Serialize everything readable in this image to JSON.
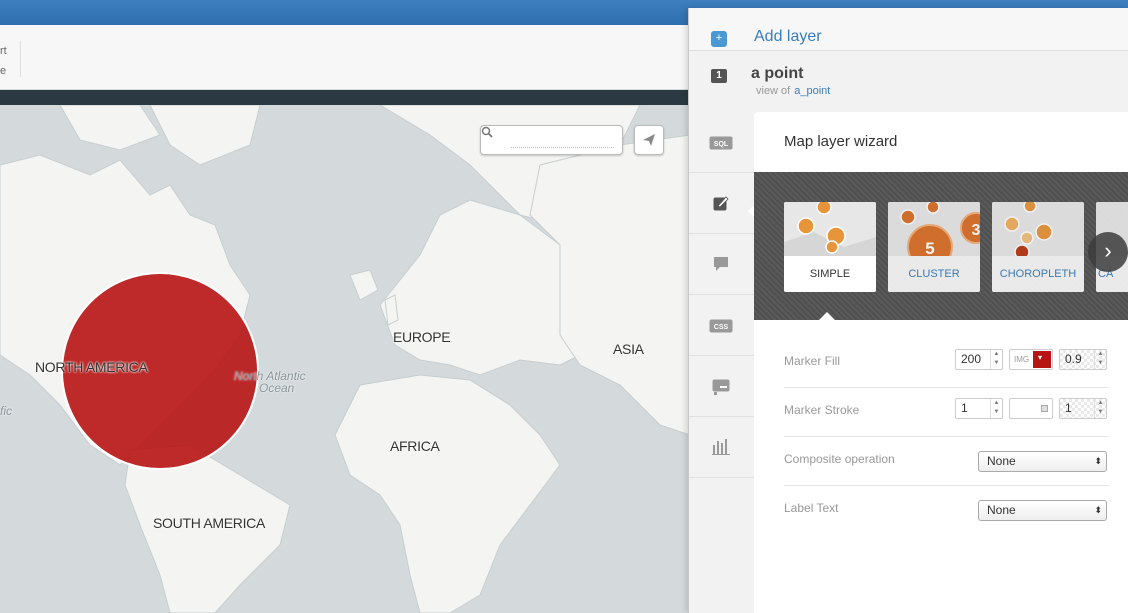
{
  "toolbar": {
    "fragment_line1": "rt",
    "fragment_line2": "e"
  },
  "map": {
    "search": {
      "placeholder": ""
    },
    "labels": {
      "north_america": "NORTH AMERICA",
      "europe": "EUROPE",
      "asia": "ASIA",
      "africa": "AFRICA",
      "south_america": "SOUTH AMERICA",
      "north_atlantic_line1": "North Atlantic",
      "north_atlantic_line2": "Ocean",
      "pacific_fragment": "fic"
    },
    "colors": {
      "water": "#d4dadc",
      "land": "#f4f4f2",
      "marker": "#b81414"
    }
  },
  "panel": {
    "add_layer": {
      "icon": "+",
      "label": "Add layer"
    },
    "layer": {
      "number": "1",
      "name": "a point",
      "view_of": "view of",
      "table": "a_point"
    },
    "side_tabs": [
      "sql-icon",
      "wizard-brush-icon",
      "infowindow-icon",
      "css-icon",
      "legend-icon",
      "chart-icon"
    ],
    "wizard": {
      "title": "Map layer wizard",
      "types": [
        {
          "label": "SIMPLE",
          "active": true
        },
        {
          "label": "CLUSTER",
          "active": false
        },
        {
          "label": "CHOROPLETH",
          "active": false
        },
        {
          "label": "CA",
          "active": false
        }
      ],
      "cluster_numbers": [
        "5",
        "3"
      ]
    },
    "form": {
      "marker_fill": {
        "label": "Marker Fill",
        "width": "200",
        "image": "IMG",
        "opacity": "0.9",
        "color": "#b81414"
      },
      "marker_stroke": {
        "label": "Marker Stroke",
        "width": "1",
        "opacity": "1"
      },
      "composite": {
        "label": "Composite operation",
        "value": "None"
      },
      "label_text": {
        "label": "Label Text",
        "value": "None"
      }
    }
  }
}
